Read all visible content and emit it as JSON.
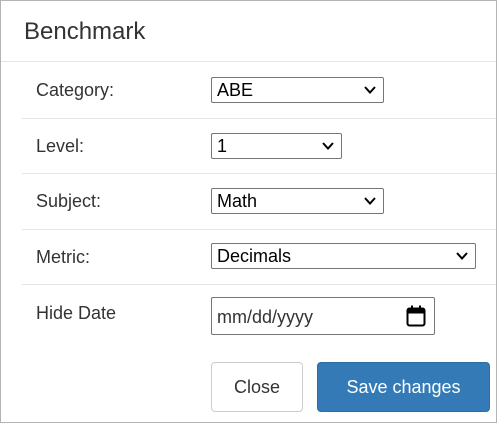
{
  "modal": {
    "title": "Benchmark"
  },
  "form": {
    "category": {
      "label": "Category:",
      "value": "ABE"
    },
    "level": {
      "label": "Level:",
      "value": "1"
    },
    "subject": {
      "label": "Subject:",
      "value": "Math"
    },
    "metric": {
      "label": "Metric:",
      "value": "Decimals"
    },
    "hide_date": {
      "label": "Hide Date",
      "placeholder": "mm/dd/yyyy"
    }
  },
  "footer": {
    "close_label": "Close",
    "save_label": "Save changes"
  },
  "colors": {
    "primary": "#337ab7",
    "border": "#e5e5e5"
  },
  "icons": {
    "select_arrow": "chevron-down-icon",
    "date_picker": "calendar-icon"
  }
}
